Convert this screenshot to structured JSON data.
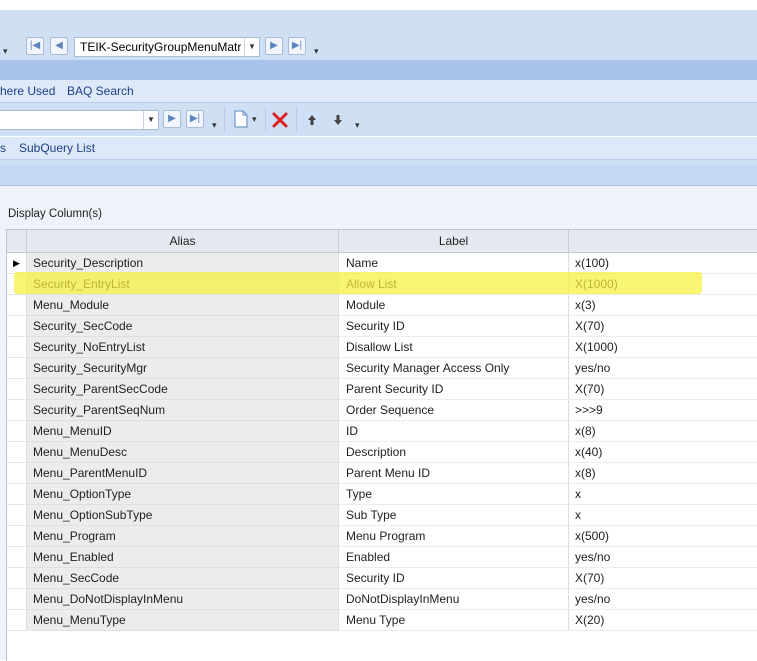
{
  "toolbar_top": {
    "record_combo_value": "TEIK-SecurityGroupMenuMatr"
  },
  "menubar1": {
    "items": [
      "here Used",
      "BAQ Search"
    ]
  },
  "menubar2": {
    "items": [
      "s",
      "SubQuery List"
    ]
  },
  "section": {
    "title": "Display Column(s)"
  },
  "grid": {
    "columns": [
      "Alias",
      "Label",
      ""
    ],
    "rows": [
      {
        "alias": "Security_Description",
        "label": "Name",
        "format": "x(100)"
      },
      {
        "alias": "Security_EntryList",
        "label": "Allow List",
        "format": "X(1000)"
      },
      {
        "alias": "Menu_Module",
        "label": "Module",
        "format": "x(3)"
      },
      {
        "alias": "Security_SecCode",
        "label": "Security ID",
        "format": "X(70)"
      },
      {
        "alias": "Security_NoEntryList",
        "label": "Disallow List",
        "format": "X(1000)"
      },
      {
        "alias": "Security_SecurityMgr",
        "label": "Security Manager Access Only",
        "format": "yes/no"
      },
      {
        "alias": "Security_ParentSecCode",
        "label": "Parent Security ID",
        "format": "X(70)"
      },
      {
        "alias": "Security_ParentSeqNum",
        "label": "Order Sequence",
        "format": ">>>9"
      },
      {
        "alias": "Menu_MenuID",
        "label": "ID",
        "format": "x(8)"
      },
      {
        "alias": "Menu_MenuDesc",
        "label": "Description",
        "format": "x(40)"
      },
      {
        "alias": "Menu_ParentMenuID",
        "label": "Parent Menu ID",
        "format": "x(8)"
      },
      {
        "alias": "Menu_OptionType",
        "label": "Type",
        "format": "x"
      },
      {
        "alias": "Menu_OptionSubType",
        "label": "Sub Type",
        "format": "x"
      },
      {
        "alias": "Menu_Program",
        "label": "Menu Program",
        "format": "x(500)"
      },
      {
        "alias": "Menu_Enabled",
        "label": "Enabled",
        "format": "yes/no"
      },
      {
        "alias": "Menu_SecCode",
        "label": "Security ID",
        "format": "X(70)"
      },
      {
        "alias": "Menu_DoNotDisplayInMenu",
        "label": "DoNotDisplayInMenu",
        "format": "yes/no"
      },
      {
        "alias": "Menu_MenuType",
        "label": "Menu Type",
        "format": "X(20)"
      }
    ]
  },
  "highlight_color": "#f6f03c",
  "delete_icon_color": "#e02020"
}
